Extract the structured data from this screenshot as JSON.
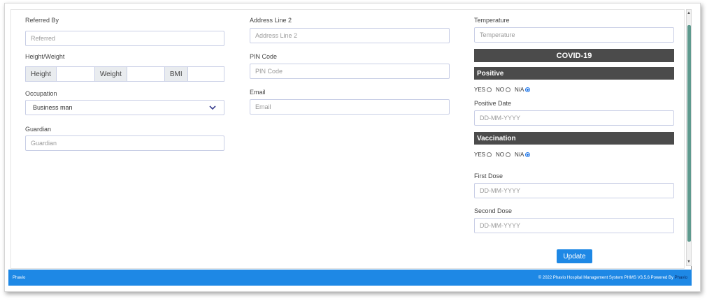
{
  "form": {
    "referred_by": {
      "label": "Referred By",
      "placeholder": "Referred"
    },
    "height_weight": {
      "label": "Height/Weight",
      "height": "Height",
      "weight": "Weight",
      "bmi": "BMI"
    },
    "occupation": {
      "label": "Occupation",
      "value": "Business man"
    },
    "guardian": {
      "label": "Guardian",
      "placeholder": "Guardian"
    },
    "address_line2": {
      "label": "Address Line 2",
      "placeholder": "Address Line 2"
    },
    "pin_code": {
      "label": "PIN Code",
      "placeholder": "PIN Code"
    },
    "email": {
      "label": "Email",
      "placeholder": "Email"
    },
    "temperature": {
      "label": "Temperature",
      "placeholder": "Temperature"
    }
  },
  "covid": {
    "title": "COVID-19",
    "positive": {
      "title": "Positive",
      "options": [
        "YES",
        "NO",
        "N/A"
      ],
      "selected": "N/A"
    },
    "positive_date": {
      "label": "Positive Date",
      "placeholder": "DD-MM-YYYY"
    },
    "vaccination": {
      "title": "Vaccination",
      "options": [
        "YES",
        "NO",
        "N/A"
      ],
      "selected": "N/A"
    },
    "first_dose": {
      "label": "First Dose",
      "placeholder": "DD-MM-YYYY"
    },
    "second_dose": {
      "label": "Second Dose",
      "placeholder": "DD-MM-YYYY"
    }
  },
  "actions": {
    "update_label": "Update"
  },
  "footer": {
    "left": "Phavio",
    "right_text": "© 2022 Phavio Hospital Management System PHMS V3.5.6 Powered By",
    "right_link": "Phavio"
  },
  "colors": {
    "accent": "#1e88e5",
    "section_bar": "#4b4b4b",
    "scroll_thumb": "#5e9a8e"
  }
}
